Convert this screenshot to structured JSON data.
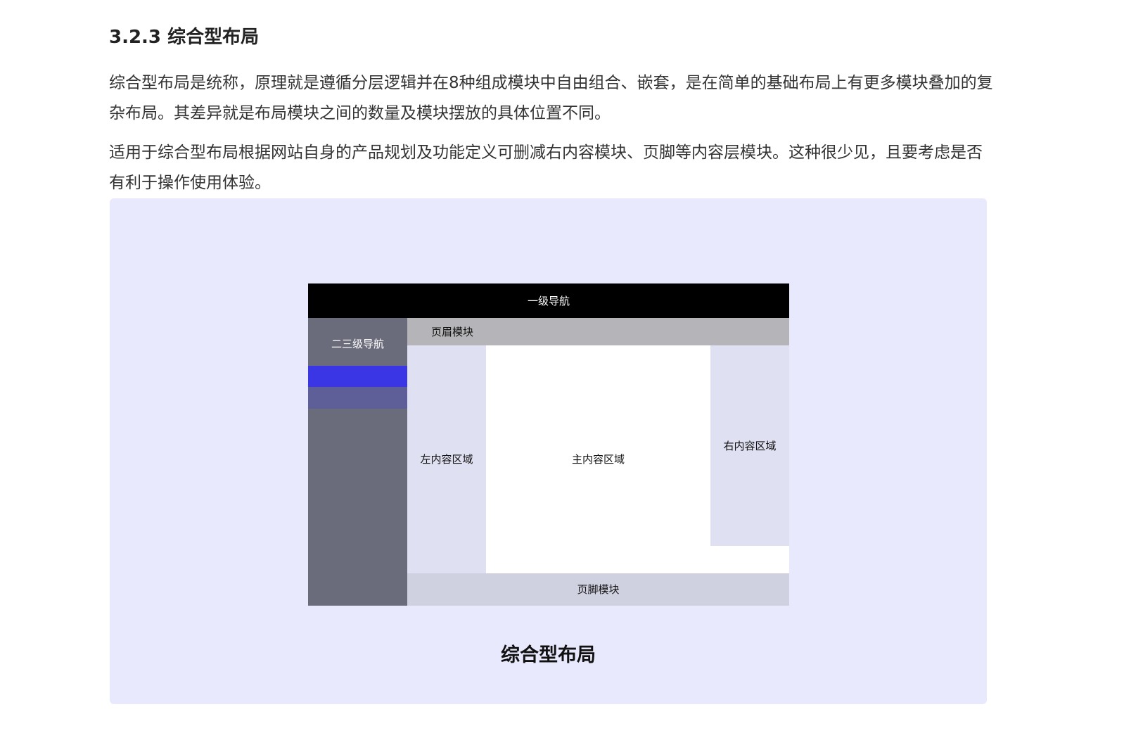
{
  "section": {
    "heading": "3.2.3 综合型布局",
    "paragraphs": [
      "综合型布局是统称，原理就是遵循分层逻辑并在8种组成模块中自由组合、嵌套，是在简单的基础布局上有更多模块叠加的复杂布局。其差异就是布局模块之间的数量及模块摆放的具体位置不同。",
      "适用于综合型布局根据网站自身的产品规划及功能定义可删减右内容模块、页脚等内容层模块。这种很少见，且要考虑是否有利于操作使用体验。"
    ]
  },
  "figure": {
    "background_color": "#e9e9fe",
    "caption": "综合型布局",
    "wireframe": {
      "top_nav": {
        "label": "一级导航",
        "color": "#000000"
      },
      "side_nav": {
        "label": "二三级导航",
        "color": "#6b6c7b",
        "active_item_color": "#3a36e6",
        "sub_item_color": "#5e5f98"
      },
      "header": {
        "label": "页眉模块",
        "color": "#b5b5b9"
      },
      "left_content": {
        "label": "左内容区域",
        "color": "#dfe0f1"
      },
      "main_content": {
        "label": "主内容区域",
        "color": "#ffffff"
      },
      "right_content": {
        "label": "右内容区域",
        "color": "#dfe0f1"
      },
      "footer": {
        "label": "页脚模块",
        "color": "#d0d1e0"
      }
    }
  }
}
